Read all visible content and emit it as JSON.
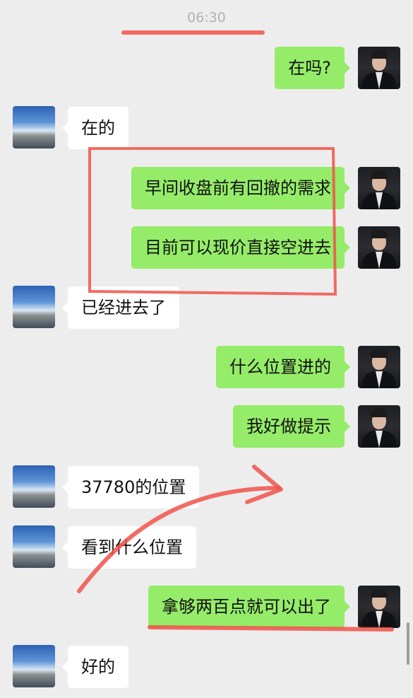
{
  "chat": {
    "timestamp": "06:30",
    "messages": [
      {
        "side": "out",
        "text": "在吗?"
      },
      {
        "side": "in",
        "text": "在的"
      },
      {
        "side": "out",
        "text": "早间收盘前有回撤的需求"
      },
      {
        "side": "out",
        "text": "目前可以现价直接空进去"
      },
      {
        "side": "in",
        "text": "已经进去了"
      },
      {
        "side": "out",
        "text": "什么位置进的"
      },
      {
        "side": "out",
        "text": "我好做提示"
      },
      {
        "side": "in",
        "text": "37780的位置"
      },
      {
        "side": "in",
        "text": "看到什么位置"
      },
      {
        "side": "out",
        "text": "拿够两百点就可以出了"
      },
      {
        "side": "in",
        "text": "好的"
      }
    ]
  },
  "colors": {
    "background": "#ededed",
    "outgoing_bubble": "#95ec69",
    "incoming_bubble": "#ffffff",
    "annotation": "#f0524a"
  },
  "icons": {
    "contact_avatar": "sea-landscape-avatar-icon",
    "self_avatar": "man-in-suit-avatar-icon"
  }
}
